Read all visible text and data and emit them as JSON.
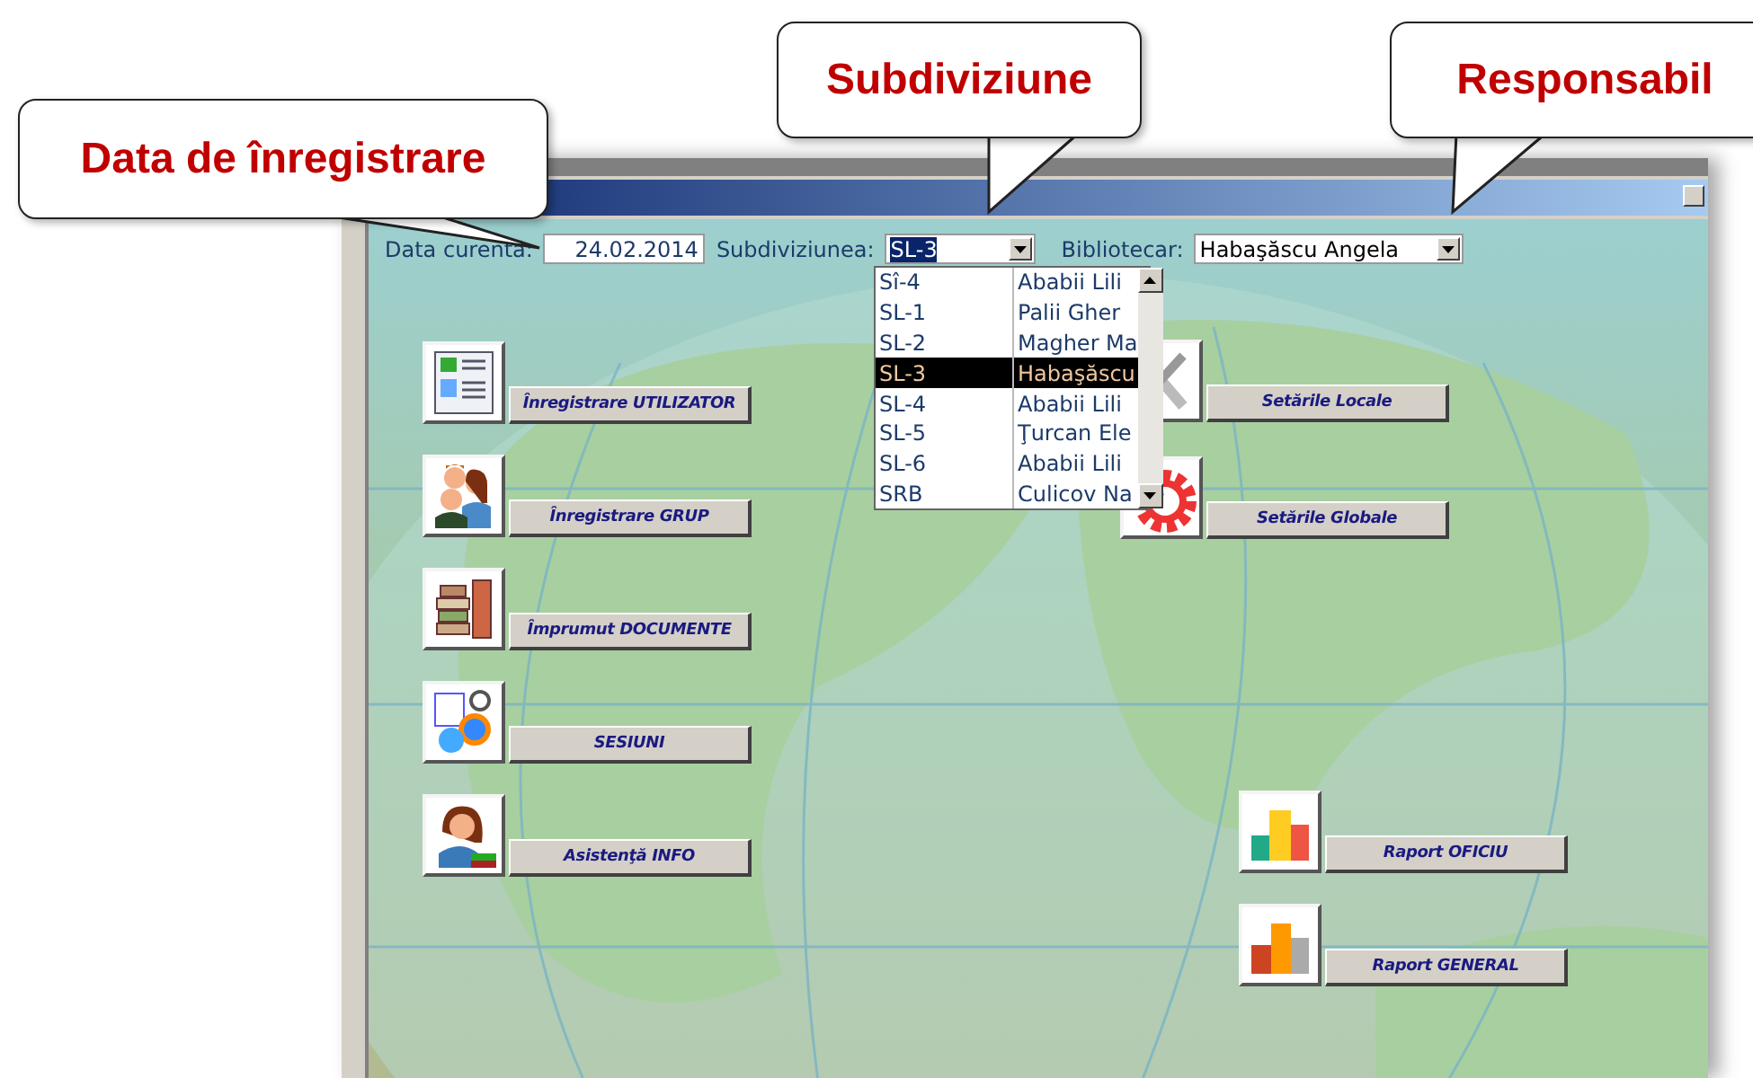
{
  "callouts": [
    {
      "text": "Data de înregistrare",
      "kind": "left"
    },
    {
      "text": "Subdiviziune",
      "kind": "down"
    },
    {
      "text": "Responsabil",
      "kind": "down"
    }
  ],
  "header": {
    "date_label": "Data curentă:",
    "date_value": "24.02.2014",
    "subdivision_label": "Subdiviziunea:",
    "subdivision_value": "SL-3",
    "librarian_label": "Bibliotecar:",
    "librarian_value": "Habaşăscu Angela"
  },
  "subdivision_dropdown": [
    {
      "code": "Sî-4",
      "name": "Ababii Lili",
      "selected": false
    },
    {
      "code": "SL-1",
      "name": "Palii Gher",
      "selected": false
    },
    {
      "code": "SL-2",
      "name": "Magher Ma",
      "selected": false
    },
    {
      "code": "SL-3",
      "name": "Habaşăscu",
      "selected": true
    },
    {
      "code": "SL-4",
      "name": "Ababii Lili",
      "selected": false
    },
    {
      "code": "SL-5",
      "name": "Ţurcan Ele",
      "selected": false
    },
    {
      "code": "SL-6",
      "name": "Ababii Lili",
      "selected": false
    },
    {
      "code": "SRB",
      "name": "Culicov Na",
      "selected": false
    }
  ],
  "main_buttons": [
    {
      "label": "Înregistrare UTILIZATOR",
      "kind": "card"
    },
    {
      "label": "Înregistrare GRUP",
      "kind": "group"
    },
    {
      "label": "Împrumut DOCUMENTE",
      "kind": "loan"
    },
    {
      "label": "SESIUNI",
      "kind": "session"
    },
    {
      "label": "Asistenţă INFO",
      "kind": "help"
    }
  ],
  "settings_buttons": [
    {
      "label": "Setările Locale",
      "kind": "local"
    },
    {
      "label": "Setările Globale",
      "kind": "global"
    }
  ],
  "report_buttons": [
    {
      "label": "Raport OFICIU",
      "kind": "office"
    },
    {
      "label": "Raport GENERAL",
      "kind": "general"
    }
  ]
}
